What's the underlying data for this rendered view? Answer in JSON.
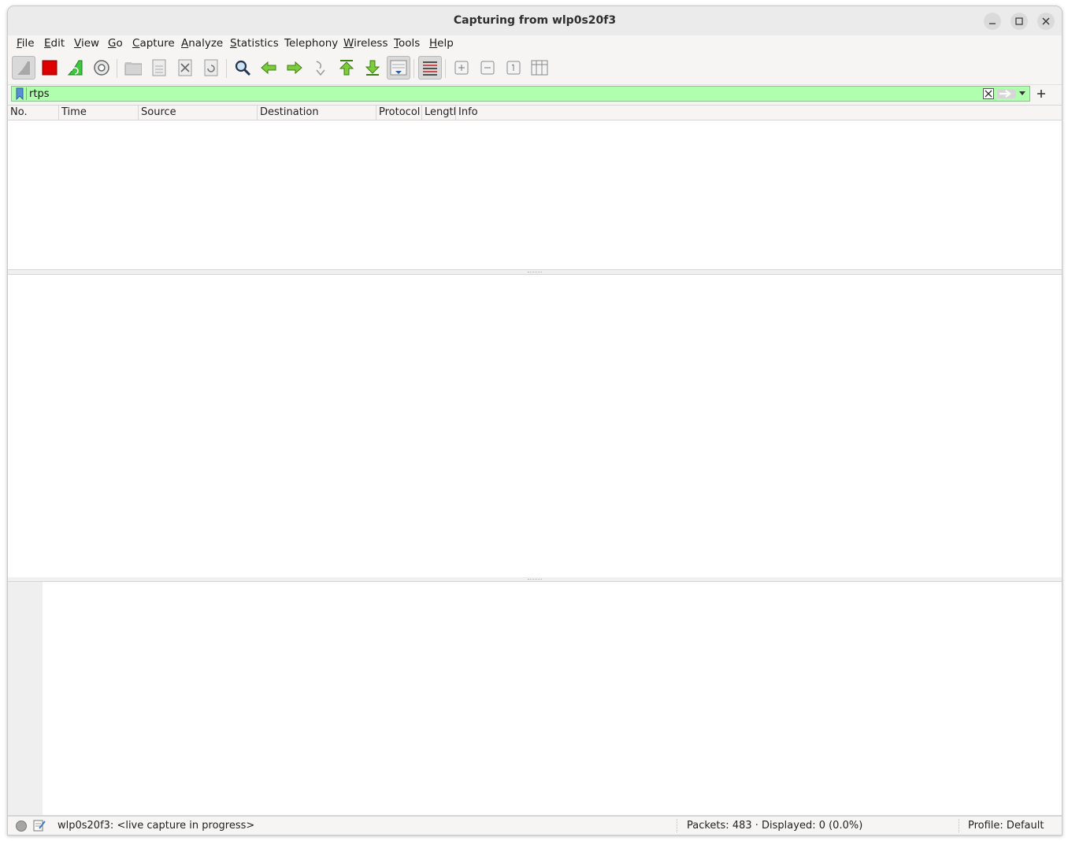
{
  "window": {
    "title": "Capturing from wlp0s20f3"
  },
  "menubar": {
    "items": [
      {
        "label": "File",
        "mnemonic": "F",
        "rest": "ile"
      },
      {
        "label": "Edit",
        "mnemonic": "E",
        "rest": "dit"
      },
      {
        "label": "View",
        "mnemonic": "V",
        "rest": "iew"
      },
      {
        "label": "Go",
        "mnemonic": "G",
        "rest": "o"
      },
      {
        "label": "Capture",
        "mnemonic": "C",
        "rest": "apture"
      },
      {
        "label": "Analyze",
        "mnemonic": "A",
        "rest": "nalyze"
      },
      {
        "label": "Statistics",
        "mnemonic": "S",
        "rest": "tatistics"
      },
      {
        "label": "Telephony",
        "mnemonic": "",
        "rest": "Telephony"
      },
      {
        "label": "Wireless",
        "mnemonic": "W",
        "rest": "ireless"
      },
      {
        "label": "Tools",
        "mnemonic": "T",
        "rest": "ools"
      },
      {
        "label": "Help",
        "mnemonic": "H",
        "rest": "elp"
      }
    ]
  },
  "toolbar": {
    "buttons": [
      "start-capture",
      "stop-capture",
      "restart-capture",
      "capture-options",
      "open-file",
      "save-file",
      "close-file",
      "reload-file",
      "find-packet",
      "go-back",
      "go-forward",
      "go-to-packet",
      "go-first",
      "go-last",
      "auto-scroll",
      "colorize",
      "zoom-in",
      "zoom-out",
      "normal-size",
      "resize-columns"
    ]
  },
  "filter": {
    "value": "rtps",
    "background": "#afffaf"
  },
  "packet_list": {
    "columns": [
      "No.",
      "Time",
      "Source",
      "Destination",
      "Protocol",
      "Length",
      "Info"
    ],
    "rows": []
  },
  "statusbar": {
    "interface_status": "wlp0s20f3: <live capture in progress>",
    "packets": "Packets: 483 · Displayed: 0 (0.0%)",
    "profile": "Profile: Default"
  }
}
